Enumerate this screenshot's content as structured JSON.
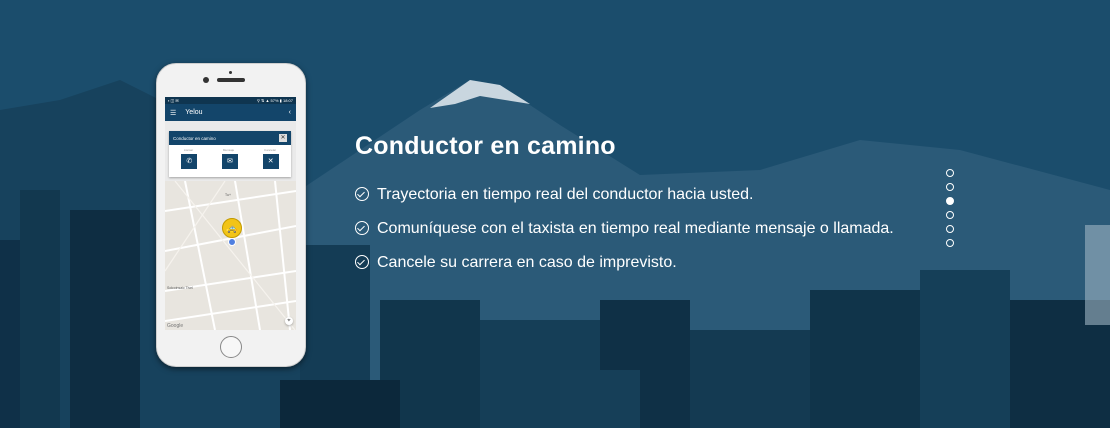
{
  "slide": {
    "heading": "Conductor en camino",
    "features": [
      {
        "text": "Trayectoria en tiempo real del conductor hacia usted."
      },
      {
        "text": "Comuníquese con el taxista en tiempo real mediante mensaje o llamada."
      },
      {
        "text": "Cancele su carrera en caso de imprevisto."
      }
    ]
  },
  "carousel": {
    "total": 6,
    "active_index": 2
  },
  "phone_app": {
    "status_left": "▪ ◫ ✉",
    "status_right": "⚲ ⇅ ▲ 57% ▮ 18:07",
    "app_title": "Yelou",
    "menu_icon": "hamburger-icon",
    "back_icon": "chevron-left-icon",
    "card_title": "Conductor en camino",
    "card_close": "✕",
    "actions": [
      {
        "label": "Llamar",
        "icon": "phone-icon",
        "glyph": "✆"
      },
      {
        "label": "Mensaje",
        "icon": "envelope-icon",
        "glyph": "✉"
      },
      {
        "label": "Cancelar",
        "icon": "close-icon",
        "glyph": "✕"
      }
    ],
    "map_you_label": "Tu+",
    "map_place_label": "Solcoinsaic Tivel",
    "map_attribution": "Google",
    "locate_glyph": "⌖"
  },
  "colors": {
    "overlay": "#1e5170",
    "app_primary": "#13456a",
    "taxi_marker": "#f2c418",
    "text": "#ffffff"
  }
}
